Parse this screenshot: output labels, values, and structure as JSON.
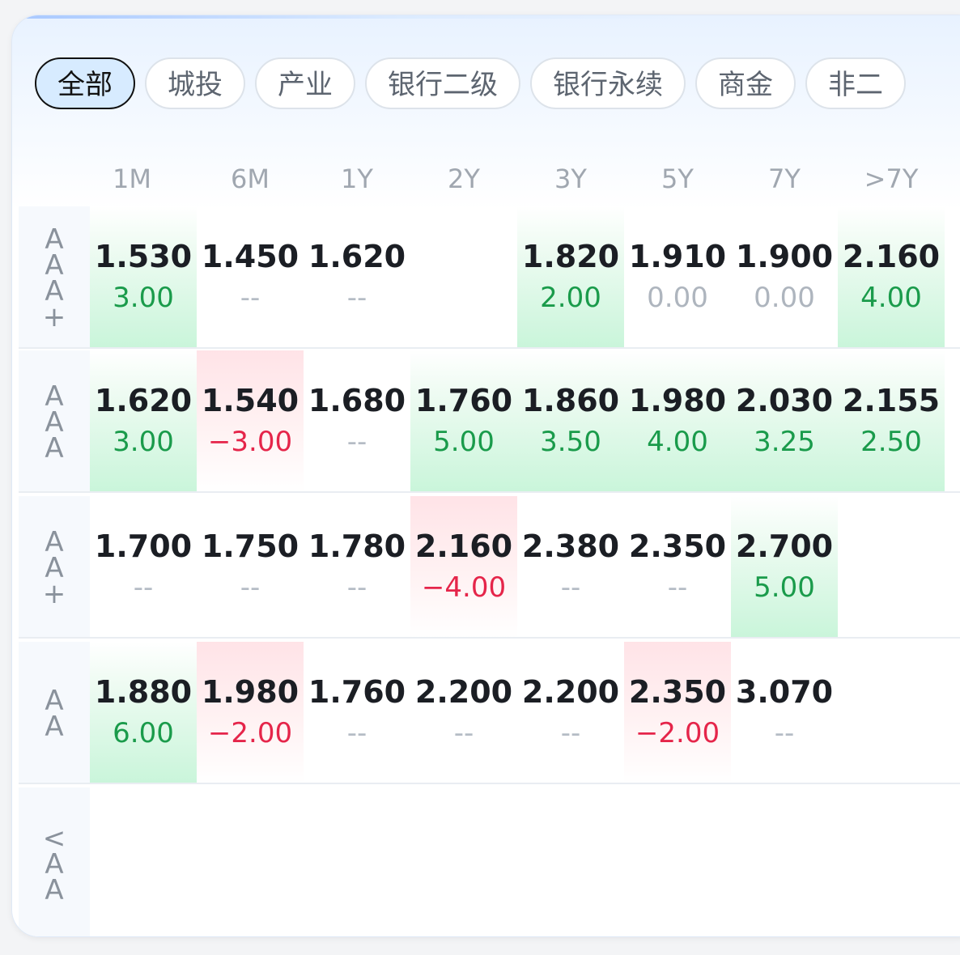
{
  "tabs": [
    "全部",
    "城投",
    "产业",
    "银行二级",
    "银行永续",
    "商金",
    "非二"
  ],
  "active_tab": 0,
  "columns": [
    "1M",
    "6M",
    "1Y",
    "2Y",
    "3Y",
    "5Y",
    "7Y",
    ">7Y"
  ],
  "rows": [
    {
      "label": "AAA+",
      "cells": [
        {
          "yield": "1.530",
          "change": "3.00",
          "trend": "up"
        },
        {
          "yield": "1.450",
          "change": "--",
          "trend": "none"
        },
        {
          "yield": "1.620",
          "change": "--",
          "trend": "none"
        },
        {
          "yield": "",
          "change": "",
          "trend": "none"
        },
        {
          "yield": "1.820",
          "change": "2.00",
          "trend": "up"
        },
        {
          "yield": "1.910",
          "change": "0.00",
          "trend": "zero"
        },
        {
          "yield": "1.900",
          "change": "0.00",
          "trend": "zero"
        },
        {
          "yield": "2.160",
          "change": "4.00",
          "trend": "up"
        }
      ]
    },
    {
      "label": "AAA",
      "cells": [
        {
          "yield": "1.620",
          "change": "3.00",
          "trend": "up"
        },
        {
          "yield": "1.540",
          "change": "−3.00",
          "trend": "down"
        },
        {
          "yield": "1.680",
          "change": "--",
          "trend": "none"
        },
        {
          "yield": "1.760",
          "change": "5.00",
          "trend": "up"
        },
        {
          "yield": "1.860",
          "change": "3.50",
          "trend": "up"
        },
        {
          "yield": "1.980",
          "change": "4.00",
          "trend": "up"
        },
        {
          "yield": "2.030",
          "change": "3.25",
          "trend": "up"
        },
        {
          "yield": "2.155",
          "change": "2.50",
          "trend": "up"
        }
      ]
    },
    {
      "label": "AA+",
      "cells": [
        {
          "yield": "1.700",
          "change": "--",
          "trend": "none"
        },
        {
          "yield": "1.750",
          "change": "--",
          "trend": "none"
        },
        {
          "yield": "1.780",
          "change": "--",
          "trend": "none"
        },
        {
          "yield": "2.160",
          "change": "−4.00",
          "trend": "down"
        },
        {
          "yield": "2.380",
          "change": "--",
          "trend": "none"
        },
        {
          "yield": "2.350",
          "change": "--",
          "trend": "none"
        },
        {
          "yield": "2.700",
          "change": "5.00",
          "trend": "up"
        },
        {
          "yield": "",
          "change": "",
          "trend": "none"
        }
      ]
    },
    {
      "label": "AA",
      "cells": [
        {
          "yield": "1.880",
          "change": "6.00",
          "trend": "up"
        },
        {
          "yield": "1.980",
          "change": "−2.00",
          "trend": "down"
        },
        {
          "yield": "1.760",
          "change": "--",
          "trend": "none"
        },
        {
          "yield": "2.200",
          "change": "--",
          "trend": "none"
        },
        {
          "yield": "2.200",
          "change": "--",
          "trend": "none"
        },
        {
          "yield": "2.350",
          "change": "−2.00",
          "trend": "down"
        },
        {
          "yield": "3.070",
          "change": "--",
          "trend": "none"
        },
        {
          "yield": "",
          "change": "",
          "trend": "none"
        }
      ]
    },
    {
      "label": "<AA",
      "cells": [
        {
          "yield": "",
          "change": "",
          "trend": "none"
        },
        {
          "yield": "",
          "change": "",
          "trend": "none"
        },
        {
          "yield": "",
          "change": "",
          "trend": "none"
        },
        {
          "yield": "",
          "change": "",
          "trend": "none"
        },
        {
          "yield": "",
          "change": "",
          "trend": "none"
        },
        {
          "yield": "",
          "change": "",
          "trend": "none"
        },
        {
          "yield": "",
          "change": "",
          "trend": "none"
        },
        {
          "yield": "",
          "change": "",
          "trend": "none"
        }
      ]
    }
  ],
  "colors": {
    "up": "#1a9b4b",
    "down": "#e5254a",
    "flat": "#b5bcc5",
    "accent": "#d7ebff"
  }
}
